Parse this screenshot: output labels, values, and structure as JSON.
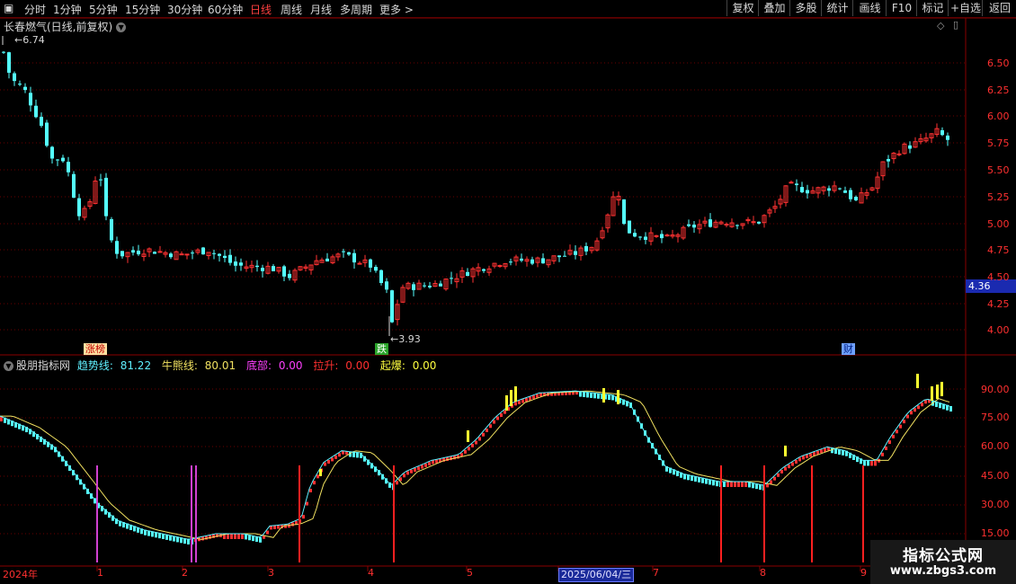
{
  "toolbar": {
    "periods": [
      "分时",
      "1分钟",
      "5分钟",
      "15分钟",
      "30分钟",
      "60分钟",
      "日线",
      "周线",
      "月线",
      "多周期",
      "更多 >"
    ],
    "active_period": "日线",
    "right_buttons": [
      "复权",
      "叠加",
      "多股",
      "统计",
      "画线",
      "F10",
      "标记",
      "+自选",
      "返回"
    ]
  },
  "stock": {
    "title": "长春燃气(日线,前复权)",
    "current_price": "4.36",
    "high_label": "6.74",
    "low_label": "3.93"
  },
  "price_axis": [
    "6.50",
    "6.25",
    "6.00",
    "5.75",
    "5.50",
    "5.25",
    "5.00",
    "4.75",
    "4.50",
    "4.25",
    "4.00"
  ],
  "badges": {
    "zhangbang": "涨榜",
    "die": "跌",
    "cai": "财"
  },
  "indicator": {
    "source": "股朋指标网",
    "items": [
      {
        "label": "趋势线:",
        "value": "81.22",
        "color": "#5ff0ff"
      },
      {
        "label": "牛熊线:",
        "value": "80.01",
        "color": "#f0e060"
      },
      {
        "label": "底部:",
        "value": "0.00",
        "color": "#ff40ff"
      },
      {
        "label": "拉升:",
        "value": "0.00",
        "color": "#ff3030"
      },
      {
        "label": "起爆:",
        "value": "0.00",
        "color": "#ffff40"
      }
    ],
    "axis": [
      "90.00",
      "75.00",
      "60.00",
      "45.00",
      "30.00",
      "15.00"
    ]
  },
  "x_axis": {
    "ticks": [
      "2024年",
      "1",
      "2",
      "3",
      "4",
      "5",
      "2025/06/04/三",
      "7",
      "8",
      "9"
    ],
    "highlight": "2025/06/04/三"
  },
  "logo": {
    "line1": "指标公式网",
    "line2": "www.zbgs3.com"
  },
  "colors": {
    "up": "#ff3232",
    "down": "#54ffff",
    "trend": "#5ff0ff",
    "bull": "#f0e060"
  }
}
